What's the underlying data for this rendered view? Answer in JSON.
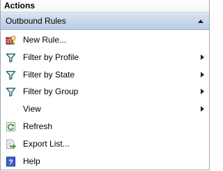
{
  "pane": {
    "title": "Actions"
  },
  "section": {
    "title": "Outbound Rules"
  },
  "items": [
    {
      "label": "New Rule...",
      "icon": "new-rule-icon",
      "submenu": false
    },
    {
      "label": "Filter by Profile",
      "icon": "filter-icon",
      "submenu": true
    },
    {
      "label": "Filter by State",
      "icon": "filter-icon",
      "submenu": true
    },
    {
      "label": "Filter by Group",
      "icon": "filter-icon",
      "submenu": true
    },
    {
      "label": "View",
      "icon": null,
      "submenu": true
    },
    {
      "label": "Refresh",
      "icon": "refresh-icon",
      "submenu": false
    },
    {
      "label": "Export List...",
      "icon": "export-list-icon",
      "submenu": false
    },
    {
      "label": "Help",
      "icon": "help-icon",
      "submenu": false
    }
  ],
  "colors": {
    "section_bg": "#c7d6ea",
    "border": "#9aa6b4",
    "text": "#000000",
    "help_blue": "#3a62c9"
  }
}
